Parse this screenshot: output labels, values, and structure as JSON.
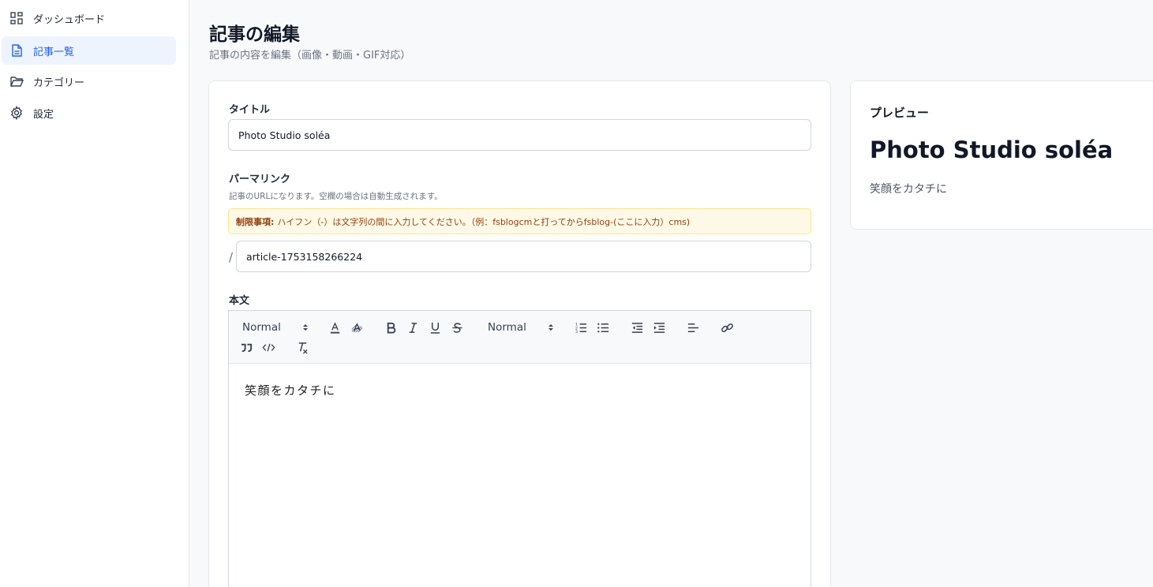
{
  "sidebar": {
    "items": [
      {
        "label": "ダッシュボード",
        "icon": "dashboard-icon",
        "active": false
      },
      {
        "label": "記事一覧",
        "icon": "document-icon",
        "active": true
      },
      {
        "label": "カテゴリー",
        "icon": "folder-icon",
        "active": false
      },
      {
        "label": "設定",
        "icon": "gear-icon",
        "active": false
      }
    ]
  },
  "header": {
    "title": "記事の編集",
    "subtitle": "記事の内容を編集（画像・動画・GIF対応）"
  },
  "form": {
    "title_label": "タイトル",
    "title_value": "Photo Studio soléa",
    "permalink_label": "パーマリンク",
    "permalink_hint": "記事のURLになります。空欄の場合は自動生成されます。",
    "notice_strong": "制限事項:",
    "notice_text": "ハイフン（-）は文字列の間に入力してください。（例：fsblogcmと打ってからfsblog-(ここに入力）cms)",
    "permalink_prefix": "/",
    "permalink_value": "article-1753158266224",
    "body_label": "本文",
    "body_content": "笑顔をカタチに"
  },
  "toolbar": {
    "heading_select": "Normal",
    "size_select": "Normal",
    "buttons": [
      "text-color",
      "background-color",
      "bold",
      "italic",
      "underline",
      "strike",
      "ordered-list",
      "bullet-list",
      "outdent",
      "indent",
      "align",
      "link",
      "blockquote",
      "code",
      "clean"
    ]
  },
  "preview": {
    "label": "プレビュー",
    "title": "Photo Studio soléa",
    "body": "笑顔をカタチに"
  },
  "colors": {
    "accent": "#2563eb",
    "active_bg": "#eef4fd",
    "notice_bg": "#fef9e7",
    "notice_border": "#fde68a",
    "notice_text": "#92400e"
  }
}
